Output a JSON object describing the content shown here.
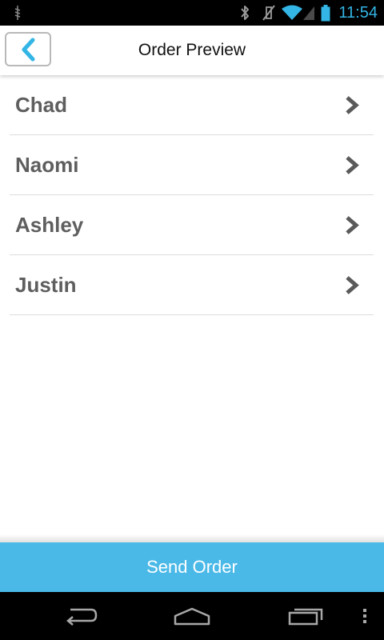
{
  "status_bar": {
    "time": "11:54",
    "icons": [
      "usb-debug-icon",
      "bluetooth-icon",
      "vibrate-off-icon",
      "wifi-icon",
      "signal-icon",
      "battery-icon"
    ]
  },
  "header": {
    "title": "Order Preview",
    "back_icon": "chevron-left-icon"
  },
  "list": {
    "items": [
      {
        "label": "Chad"
      },
      {
        "label": "Naomi"
      },
      {
        "label": "Ashley"
      },
      {
        "label": "Justin"
      }
    ],
    "item_icon": "chevron-right-icon"
  },
  "footer": {
    "send_label": "Send Order"
  },
  "nav_bar": {
    "buttons": [
      "back-icon",
      "home-icon",
      "recent-apps-icon",
      "overflow-menu-icon"
    ]
  },
  "colors": {
    "accent": "#33b5e5",
    "button": "#4ab9e8",
    "text": "#5e5e5e"
  }
}
